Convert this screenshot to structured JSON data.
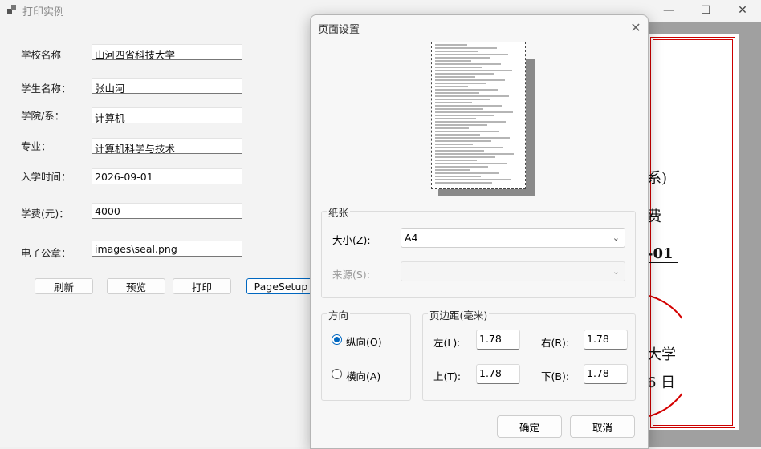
{
  "window": {
    "title": "打印实例",
    "minimize_glyph": "—",
    "maximize_glyph": "☐",
    "close_glyph": "✕"
  },
  "form": {
    "fields": [
      {
        "label": "学校名称",
        "value": "山河四省科技大学"
      },
      {
        "label": "学生名称：",
        "value": "张山河"
      },
      {
        "label": "学院/系：",
        "value": "计算机"
      },
      {
        "label": "专业：",
        "value": "计算机科学与技术"
      },
      {
        "label": "入学时间：",
        "value": "2026-09-01"
      },
      {
        "label": "学费(元)：",
        "value": "4000"
      },
      {
        "label": "电子公章：",
        "value": "images\\seal.png"
      }
    ],
    "buttons": {
      "refresh": "刷新",
      "preview": "预览",
      "print": "打印",
      "pagesetup": "PageSetup"
    }
  },
  "preview_fragments": {
    "t1": "系)",
    "t2": "费",
    "t3": "-01",
    "t4": "大学",
    "t5": "6 日"
  },
  "dialog": {
    "title": "页面设置",
    "close_glyph": "✕",
    "paper": {
      "legend": "纸张",
      "size_label": "大小(Z):",
      "size_value": "A4",
      "source_label": "来源(S):",
      "source_value": ""
    },
    "orientation": {
      "legend": "方向",
      "portrait": "纵向(O)",
      "landscape": "横向(A)",
      "selected": "portrait"
    },
    "margins": {
      "legend": "页边距(毫米)",
      "left_label": "左(L):",
      "left": "1.78",
      "right_label": "右(R):",
      "right": "1.78",
      "top_label": "上(T):",
      "top": "1.78",
      "bottom_label": "下(B):",
      "bottom": "1.78"
    },
    "ok": "确定",
    "cancel": "取消"
  },
  "colors": {
    "accent": "#0067c0",
    "seal_red": "#d40000"
  }
}
